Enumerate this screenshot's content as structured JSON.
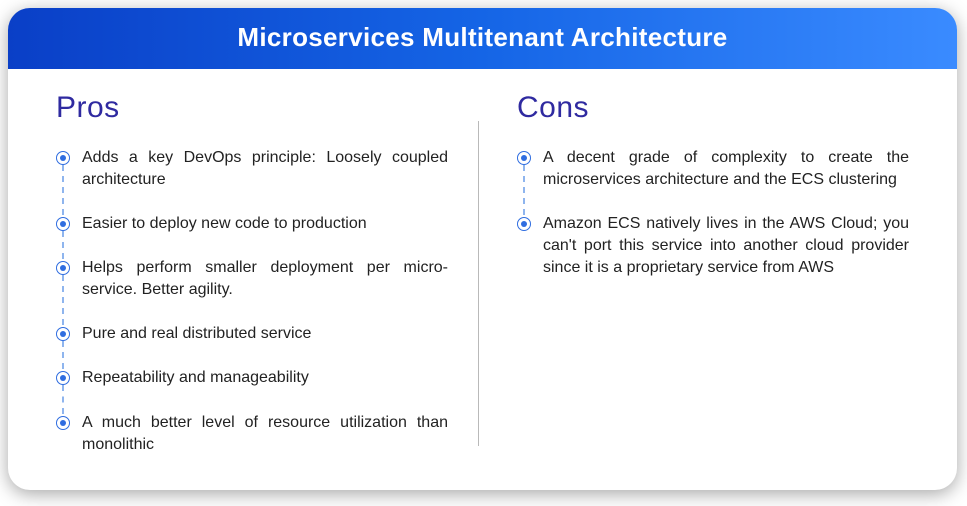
{
  "title": "Microservices Multitenant Architecture",
  "pros": {
    "heading": "Pros",
    "items": [
      "Adds a key DevOps principle: Loosely coupled architecture",
      "Easier to deploy new code to production",
      "Helps perform smaller deployment per micro-service. Better agility.",
      "Pure and real distributed service",
      "Repeatability and manageability",
      "A much better level of resource utilization than monolithic"
    ]
  },
  "cons": {
    "heading": "Cons",
    "items": [
      "A decent grade of complexity to create the microservices architecture and the ECS clustering",
      "Amazon ECS natively lives in the AWS Cloud; you can't port this service into another cloud provider since it is a proprietary service from AWS"
    ]
  },
  "colors": {
    "heading": "#2f2aa0",
    "bullet": "#2f6de0",
    "gradient_from": "#0a3fc7",
    "gradient_to": "#3a8bff"
  }
}
